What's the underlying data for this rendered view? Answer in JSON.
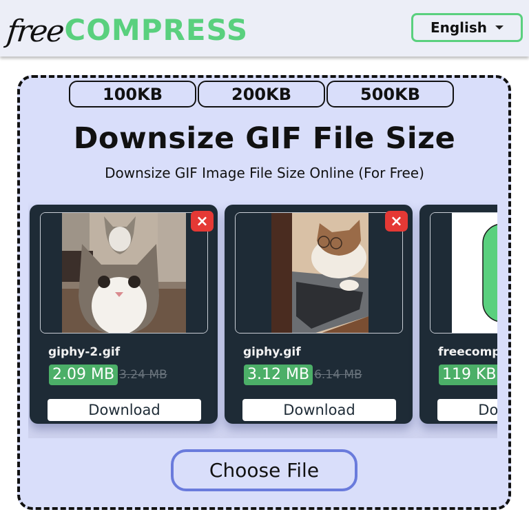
{
  "header": {
    "logo_free": "free",
    "logo_compress": "COMPRESS",
    "language": "English"
  },
  "size_tabs": [
    {
      "label": "100KB"
    },
    {
      "label": "200KB"
    },
    {
      "label": "500KB"
    }
  ],
  "main": {
    "title": "Downsize GIF File Size",
    "subtitle": "Downsize GIF Image File Size Online (For Free)",
    "choose_file_label": "Choose File"
  },
  "files": [
    {
      "name": "giphy-2.gif",
      "compressed_size": "2.09 MB",
      "original_size": "3.24 MB",
      "download_label": "Download",
      "remove_icon": "×",
      "thumbnail": "cat-staring-with-cat-behind"
    },
    {
      "name": "giphy.gif",
      "compressed_size": "3.12 MB",
      "original_size": "6.14 MB",
      "download_label": "Download",
      "remove_icon": "×",
      "thumbnail": "cat-with-glasses-at-laptop"
    },
    {
      "name": "freecomp",
      "compressed_size": "119 KB",
      "original_size": "",
      "download_label": "Download",
      "thumbnail": "green-rounded-logo"
    }
  ],
  "colors": {
    "brand_green": "#5ad07e",
    "size_badge_green": "#4caf68",
    "remove_red": "#e53935",
    "card_dark": "#1e2b36",
    "dropzone_bg": "#d9defa",
    "choose_border": "#6a7bdc"
  }
}
